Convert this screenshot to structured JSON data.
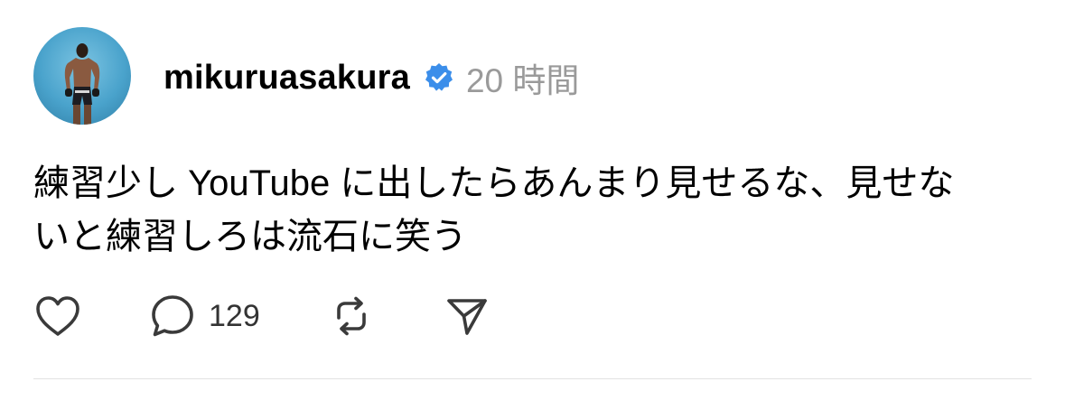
{
  "post": {
    "author": {
      "username": "mikuruasakura",
      "verified": true,
      "avatar_icon": "profile-photo"
    },
    "timestamp": "20 時間",
    "text_lines": [
      "練習少し YouTube に出したらあんまり見せるな、見せな",
      "いと練習しろは流石に笑う"
    ],
    "actions": {
      "like_icon": "heart-icon",
      "reply_icon": "speech-bubble-icon",
      "reply_count": "129",
      "repost_icon": "repost-icon",
      "share_icon": "send-icon"
    }
  },
  "colors": {
    "text": "#000000",
    "muted": "#9a9a9a",
    "verified_badge": "#3b8eea",
    "divider": "#e2e2e2"
  }
}
